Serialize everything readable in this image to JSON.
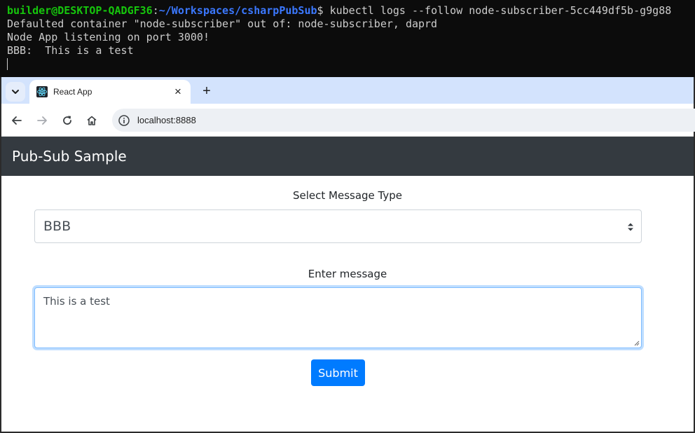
{
  "terminal": {
    "prompt_user": "builder@DESKTOP-QADGF36",
    "prompt_sep": ":",
    "prompt_path": "~/Workspaces/csharpPubSub",
    "prompt_end": "$ ",
    "command": "kubectl logs --follow node-subscriber-5cc449df5b-g9g88",
    "output": [
      "Defaulted container \"node-subscriber\" out of: node-subscriber, daprd",
      "Node App listening on port 3000!",
      "BBB:  This is a test"
    ]
  },
  "browser": {
    "tab": {
      "title": "React App",
      "favicon": "react-logo-icon",
      "close": "×"
    },
    "new_tab": "+",
    "url": "localhost:8888"
  },
  "app": {
    "title": "Pub-Sub Sample",
    "select_label": "Select Message Type",
    "select_value": "BBB",
    "message_label": "Enter message",
    "message_value": "This is a test",
    "submit_label": "Submit"
  },
  "colors": {
    "terminal_bg": "#0c0c0c",
    "prompt_user": "#16c60c",
    "prompt_path": "#3b78ff",
    "header_bg": "#343a40",
    "primary": "#007bff",
    "tabbar_bg": "#d3e3fd"
  }
}
